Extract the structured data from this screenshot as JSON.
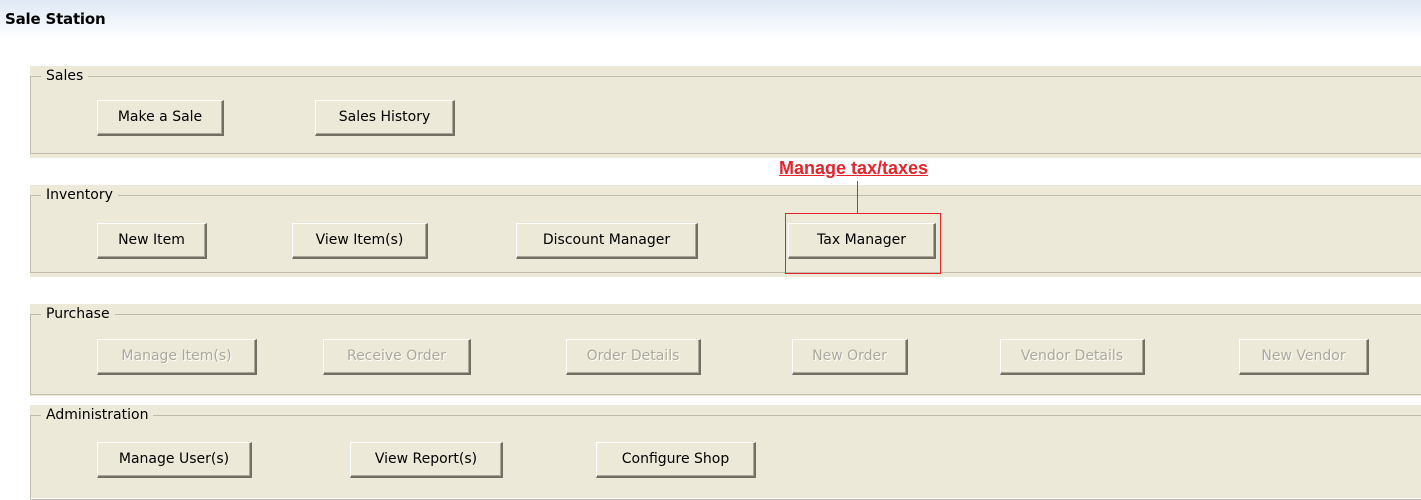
{
  "window": {
    "title": "Sale Station"
  },
  "annotation": {
    "label": "Manage tax/taxes",
    "color": "#e8232b",
    "target": "Tax Manager"
  },
  "sections": {
    "sales": {
      "legend": "Sales",
      "buttons": [
        {
          "label": "Make a Sale",
          "enabled": true
        },
        {
          "label": "Sales History",
          "enabled": true
        }
      ]
    },
    "inventory": {
      "legend": "Inventory",
      "buttons": [
        {
          "label": "New Item",
          "enabled": true
        },
        {
          "label": "View Item(s)",
          "enabled": true
        },
        {
          "label": "Discount Manager",
          "enabled": true
        },
        {
          "label": "Tax Manager",
          "enabled": true
        }
      ]
    },
    "purchase": {
      "legend": "Purchase",
      "buttons": [
        {
          "label": "Manage Item(s)",
          "enabled": false
        },
        {
          "label": "Receive Order",
          "enabled": false
        },
        {
          "label": "Order Details",
          "enabled": false
        },
        {
          "label": "New Order",
          "enabled": false
        },
        {
          "label": "Vendor Details",
          "enabled": false
        },
        {
          "label": "New Vendor",
          "enabled": false
        }
      ]
    },
    "administration": {
      "legend": "Administration",
      "buttons": [
        {
          "label": "Manage User(s)",
          "enabled": true
        },
        {
          "label": "View Report(s)",
          "enabled": true
        },
        {
          "label": "Configure Shop",
          "enabled": true
        }
      ]
    }
  },
  "colors": {
    "panel_background": "#ece9d8",
    "disabled_text": "#aca899"
  }
}
